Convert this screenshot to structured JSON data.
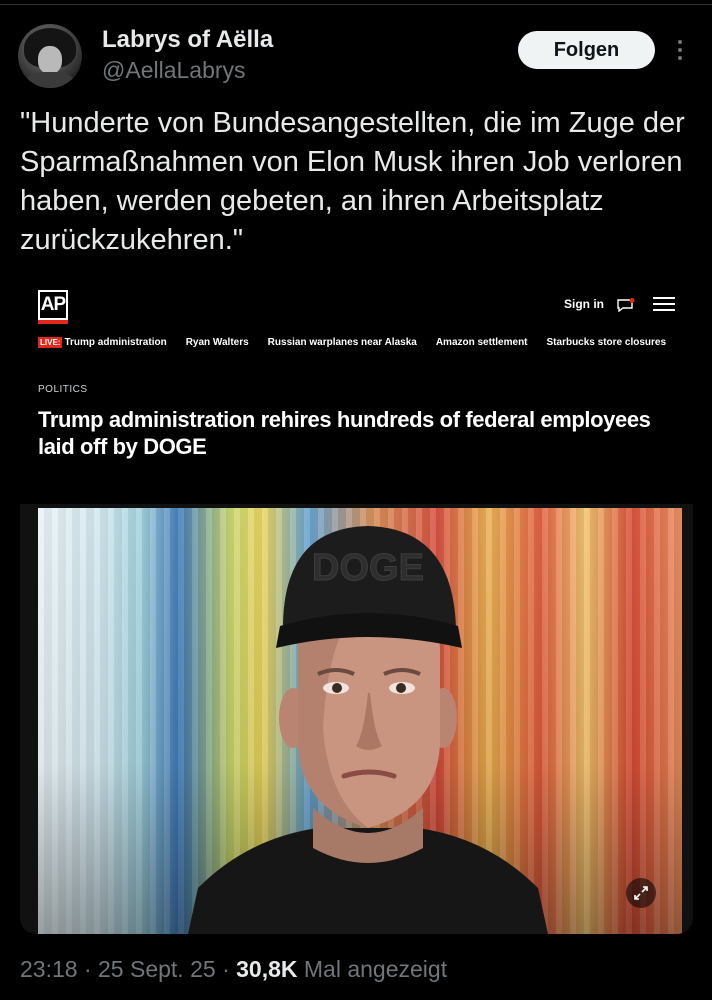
{
  "author": {
    "display_name": "Labrys of Aëlla",
    "handle": "@AellaLabrys"
  },
  "actions": {
    "follow_label": "Folgen"
  },
  "tweet": {
    "text": "\"Hunderte von Bundesangestellten, die im Zuge der Sparmaßnahmen von Elon Musk ihren Job verloren haben, werden gebeten, an ihren Arbeitsplatz zurückzukehren.\""
  },
  "media": {
    "site_logo": "AP",
    "signin_label": "Sign in",
    "live_label": "LIVE:",
    "ticker": [
      "Trump administration",
      "Ryan Walters",
      "Russian warplanes near Alaska",
      "Amazon settlement",
      "Starbucks store closures"
    ],
    "kicker": "POLITICS",
    "headline": "Trump administration rehires hundreds of federal employees laid off by DOGE",
    "cap_text": "DOGE",
    "icons": [
      "ap-logo",
      "chat-notification-icon",
      "hamburger-menu-icon",
      "expand-icon"
    ],
    "accent_color": "#e3281b"
  },
  "footer": {
    "time": "23:18",
    "date": "25 Sept. 25",
    "separator": "·",
    "views": "30,8K",
    "views_label": "Mal angezeigt"
  }
}
